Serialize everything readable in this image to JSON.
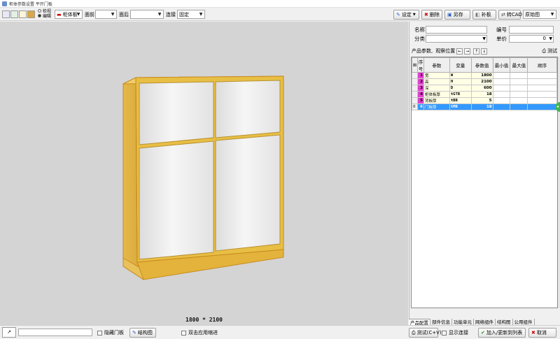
{
  "window": {
    "title": "柜体参数设置  平开门板"
  },
  "toolbar": {
    "mode_labels": [
      "检视",
      "编辑"
    ],
    "type_combo": "柜体板",
    "front_label": "面前",
    "front_value": "",
    "back_label": "面后",
    "back_value": "",
    "connect_label": "连接",
    "connect_value": "固定",
    "settings_button": "设定",
    "delete_button": "删除",
    "save_as_button": "另存",
    "patch_button": "补板",
    "cad_button": "转CAD",
    "view_combo": "原始图"
  },
  "form": {
    "name_label": "名称",
    "name_value": "",
    "code_label": "编号",
    "code_value": "",
    "category_label": "分类",
    "category_value": "",
    "price_label": "单价",
    "price_value": "0"
  },
  "params_bar": {
    "label": "产品参数,",
    "view_label": "观察位置",
    "test_button": "测试"
  },
  "grid": {
    "headers": [
      "序号",
      "参数",
      "变量",
      "参数值",
      "最小值",
      "最大值",
      "顺序"
    ],
    "rows": [
      {
        "seq": "1",
        "param": "宽",
        "var": "W",
        "value": "1800",
        "min": "",
        "max": "",
        "order": ""
      },
      {
        "seq": "2",
        "param": "高",
        "var": "H",
        "value": "2100",
        "min": "",
        "max": "",
        "order": ""
      },
      {
        "seq": "3",
        "param": "深",
        "var": "D",
        "value": "600",
        "min": "",
        "max": "",
        "order": ""
      },
      {
        "seq": "4",
        "param": "柜体板厚",
        "var": "tGTB",
        "value": "18",
        "min": "",
        "max": "",
        "order": ""
      },
      {
        "seq": "5",
        "param": "背板厚",
        "var": "tBB",
        "value": "5",
        "min": "",
        "max": "",
        "order": ""
      },
      {
        "seq": "6",
        "param": "门板厚",
        "var": "tMB",
        "value": "18",
        "min": "",
        "max": "",
        "order": ""
      }
    ],
    "indicator": "0"
  },
  "viewport": {
    "dimension_text": "1800 * 2100"
  },
  "tabs": [
    "产品配置",
    "部件信息",
    "功能单元",
    "网络组件",
    "结构图",
    "公用组件"
  ],
  "status": {
    "hide_door_label": "隐藏门板",
    "structure_button": "结构图",
    "apply_label": "双击应用缩进",
    "show_connect_label": "显示连接",
    "test_cv_button": "测试(C+V)",
    "add_update_button": "加入/更新到列表",
    "cancel_button": "取消"
  },
  "colors": {
    "frame_wood": "#e8bf45",
    "frame_edge": "#c98a1e",
    "door_panel": "#efefef",
    "selected_row": "#3399ff",
    "seq_cell": "#e33fcf",
    "viewport_bg": "#d4d4d4"
  }
}
